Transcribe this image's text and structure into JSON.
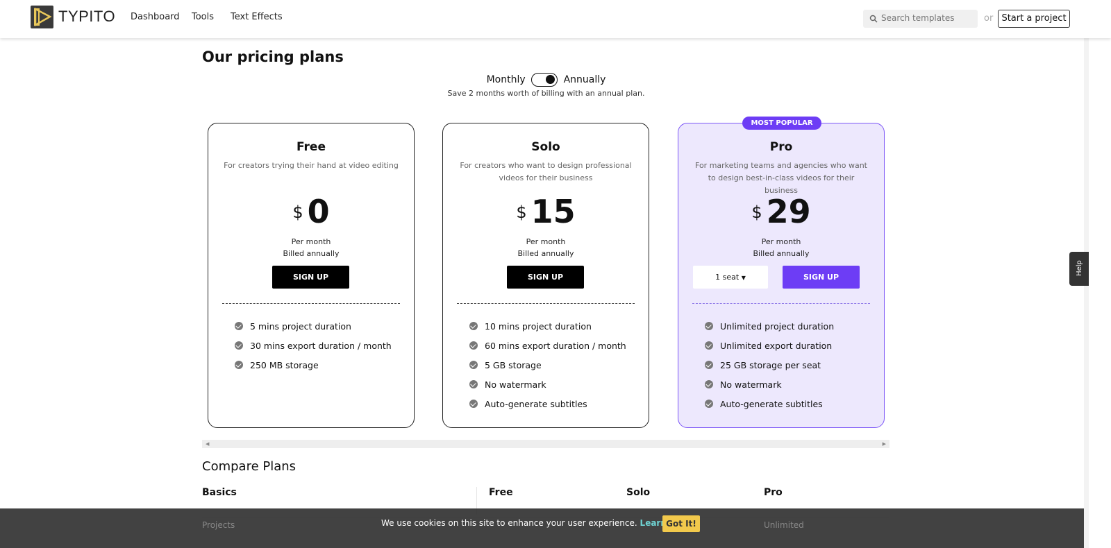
{
  "header": {
    "brand": "TYPITO",
    "nav": [
      "Dashboard",
      "Tools",
      "Text Effects"
    ],
    "search_placeholder": "Search templates",
    "or": "or",
    "start_project": "Start a project"
  },
  "pricing": {
    "title": "Our pricing plans",
    "monthly": "Monthly",
    "annually": "Annually",
    "annual_selected": true,
    "save_note": "Save 2 months worth of billing with an annual plan.",
    "plans": [
      {
        "name": "Free",
        "desc": "For creators trying their hand at video editing",
        "currency": "$",
        "price": "0",
        "per": "Per month",
        "billed": "Billed annually",
        "cta": "SIGN UP",
        "features": [
          "5 mins project duration",
          "30 mins export duration / month",
          "250 MB storage"
        ]
      },
      {
        "name": "Solo",
        "desc": "For creators who want to design professional videos for their business",
        "currency": "$",
        "price": "15",
        "per": "Per month",
        "billed": "Billed annually",
        "cta": "SIGN UP",
        "features": [
          "10 mins project duration",
          "60 mins export duration / month",
          "5 GB storage",
          "No watermark",
          "Auto-generate subtitles"
        ]
      },
      {
        "name": "Pro",
        "badge": "MOST POPULAR",
        "desc": "For marketing teams and agencies who want to design best-in-class videos for their business",
        "currency": "$",
        "price": "29",
        "per": "Per month",
        "billed": "Billed annually",
        "seats": "1 seat",
        "cta": "SIGN UP",
        "features": [
          "Unlimited project duration",
          "Unlimited export duration",
          "25 GB storage per seat",
          "No watermark",
          "Auto-generate subtitles"
        ]
      }
    ],
    "accent": "#6d3df5"
  },
  "compare": {
    "title": "Compare Plans",
    "headers": [
      "Basics",
      "Free",
      "Solo",
      "Pro"
    ],
    "row": [
      "Projects",
      "Unlimited",
      "Unlimited",
      "Unlimited"
    ]
  },
  "cookie": {
    "message": "We use cookies on this site to enhance your user experience.",
    "learn_more": "Learn More",
    "got_it": "Got It!"
  },
  "help": "Help"
}
